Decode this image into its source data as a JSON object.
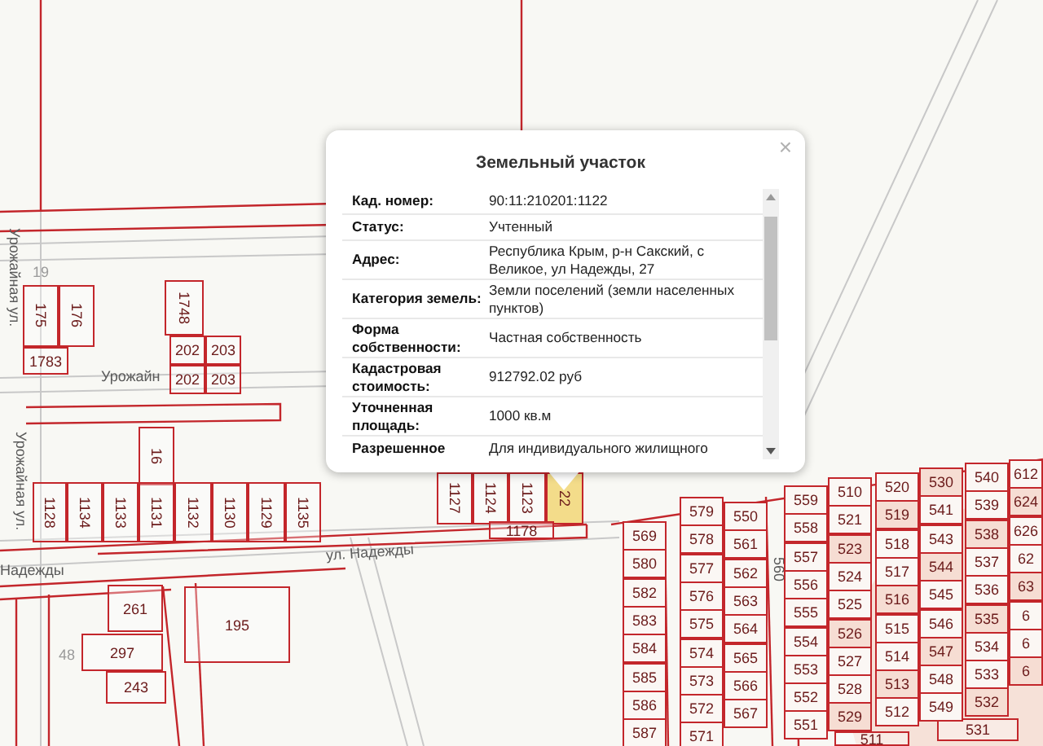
{
  "map": {
    "streets": [
      "Урожайная ул.",
      "Урожайная ул.",
      "Урожайн",
      "ул. Надежды",
      "Надежды",
      "560"
    ],
    "marks": [
      "19",
      "48"
    ],
    "parcels": [
      {
        "label": "175",
        "selected": false
      },
      {
        "label": "176",
        "selected": false
      },
      {
        "label": "1783",
        "selected": false
      },
      {
        "label": "1748",
        "selected": false
      },
      {
        "label": "202",
        "selected": false
      },
      {
        "label": "203",
        "selected": false
      },
      {
        "label": "202",
        "selected": false
      },
      {
        "label": "203",
        "selected": false
      },
      {
        "label": "16",
        "selected": false
      },
      {
        "label": "1128",
        "selected": false
      },
      {
        "label": "1134",
        "selected": false
      },
      {
        "label": "1133",
        "selected": false
      },
      {
        "label": "1131",
        "selected": false
      },
      {
        "label": "1132",
        "selected": false
      },
      {
        "label": "1130",
        "selected": false
      },
      {
        "label": "1129",
        "selected": false
      },
      {
        "label": "1135",
        "selected": false
      },
      {
        "label": "1127",
        "selected": false
      },
      {
        "label": "1124",
        "selected": false
      },
      {
        "label": "1123",
        "selected": false
      },
      {
        "label": "22",
        "selected": true
      },
      {
        "label": "1178",
        "selected": false
      },
      {
        "label": "261",
        "selected": false
      },
      {
        "label": "297",
        "selected": false
      },
      {
        "label": "243",
        "selected": false
      },
      {
        "label": "195",
        "selected": false
      },
      {
        "label": "511",
        "selected": false
      },
      {
        "label": "531",
        "selected": false
      }
    ],
    "grid": [
      {
        "cells": [
          "569",
          "580",
          "582",
          "583",
          "584",
          "585",
          "586",
          "587"
        ]
      },
      {
        "cells": [
          "579",
          "578",
          "577",
          "576",
          "575",
          "574",
          "573",
          "572",
          "571"
        ]
      },
      {
        "cells": [
          "550",
          "561",
          "562",
          "563",
          "564",
          "565",
          "566",
          "567"
        ]
      },
      {
        "cells": [
          "559",
          "558",
          "557",
          "556",
          "555",
          "554",
          "553",
          "552",
          "551"
        ]
      },
      {
        "cells": [
          "510",
          "521",
          "523",
          "524",
          "525",
          "526",
          "527",
          "528",
          "529"
        ]
      },
      {
        "cells": [
          "520",
          "519",
          "518",
          "517",
          "516",
          "515",
          "514",
          "513",
          "512"
        ]
      },
      {
        "cells": [
          "530",
          "541",
          "543",
          "544",
          "545",
          "546",
          "547",
          "548",
          "549"
        ]
      },
      {
        "cells": [
          "540",
          "539",
          "538",
          "537",
          "536",
          "535",
          "534",
          "533",
          "532"
        ]
      },
      {
        "cells": [
          "612",
          "624",
          "626",
          "62",
          "63",
          "6",
          "6",
          "6"
        ]
      }
    ]
  },
  "popup": {
    "title": "Земельный участок",
    "close": "×",
    "rows": [
      {
        "label": "Кад. номер:",
        "value": "90:11:210201:1122"
      },
      {
        "label": "Статус:",
        "value": "Учтенный"
      },
      {
        "label": "Адрес:",
        "value": "Республика Крым, р-н Сакский, с Великое, ул Надежды, 27"
      },
      {
        "label": "Категория земель:",
        "value": "Земли поселений (земли населенных пунктов)"
      },
      {
        "label": "Форма собственности:",
        "value": "Частная собственность"
      },
      {
        "label": "Кадастровая стоимость:",
        "value": "912792.02 руб"
      },
      {
        "label": "Уточненная площадь:",
        "value": "1000 кв.м"
      },
      {
        "label": "Разрешенное",
        "value": "Для индивидуального жилищного"
      }
    ]
  }
}
